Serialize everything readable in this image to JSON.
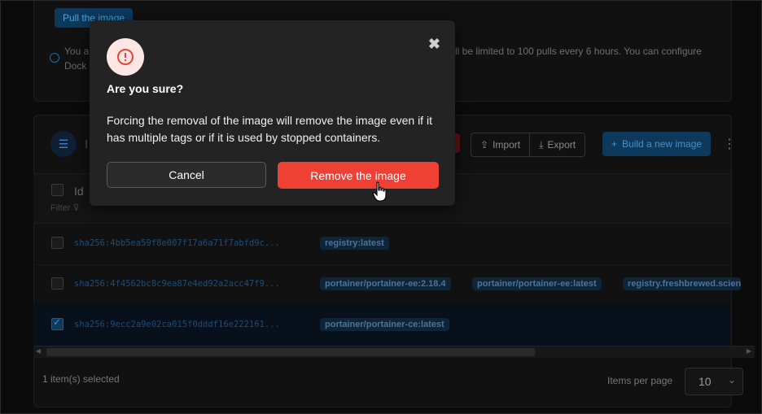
{
  "background": {
    "pull_button_label": "Pull the image",
    "info_text_line1": "You a",
    "info_text_right": "ll be limited to 100 pulls every 6 hours. You can configure",
    "info_text_line2": "Dock",
    "section_title": "I",
    "toolbar": {
      "import_label": "Import",
      "export_label": "Export",
      "build_label": "Build a new image"
    },
    "table": {
      "header_id": "Id",
      "filter_label": "Filter",
      "rows": [
        {
          "hash": "sha256:4bb5ea59f8e007f17a6a71f7abfd9c...",
          "tags": [
            "registry:latest"
          ],
          "checked": false
        },
        {
          "hash": "sha256:4f4562bc8c9ea87e4ed92a2acc47f9...",
          "tags": [
            "portainer/portainer-ee:2.18.4",
            "portainer/portainer-ee:latest",
            "registry.freshbrewed.scien"
          ],
          "checked": false
        },
        {
          "hash": "sha256:9ecc2a9e02ca015f0dddf16e222161...",
          "tags": [
            "portainer/portainer-ce:latest"
          ],
          "checked": true
        }
      ]
    },
    "footer": {
      "selected_count": "1 item(s) selected",
      "items_per_page_label": "Items per page",
      "items_per_page_value": "10"
    }
  },
  "modal": {
    "title": "Are you sure?",
    "body": "Forcing the removal of the image will remove the image even if it has multiple tags or if it is used by stopped containers.",
    "cancel_label": "Cancel",
    "confirm_label": "Remove the image",
    "close_glyph": "✖"
  },
  "colors": {
    "danger": "#ef4035",
    "modal_bg": "#232323",
    "link_blue": "#1d4d78"
  }
}
